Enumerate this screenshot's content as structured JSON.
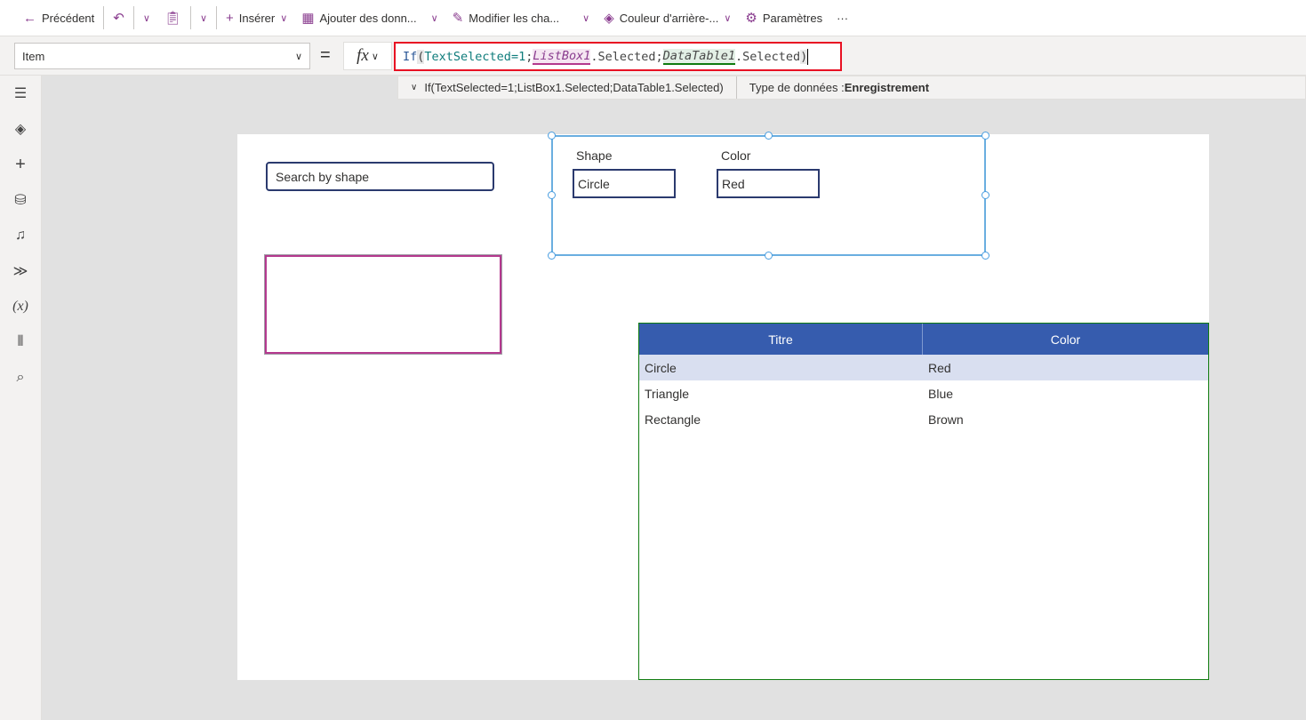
{
  "toolbar": {
    "back": "Précédent",
    "insert": "Insérer",
    "add_data": "Ajouter des donn...",
    "edit_fields": "Modifier les cha...",
    "background": "Couleur d'arrière-...",
    "settings": "Paramètres",
    "more": "···"
  },
  "formula_bar": {
    "property": "Item",
    "equals": "=",
    "fx": "fx",
    "tokens": {
      "if": "If",
      "open": "(",
      "cond": "TextSelected=1",
      "sep1": ";",
      "listbox": "ListBox1",
      "sel1": ".Selected",
      "sep2": ";",
      "datatable": "DataTable1",
      "sel2": ".Selected",
      "close": ")"
    },
    "hint_formula": "If(TextSelected=1;ListBox1.Selected;DataTable1.Selected)",
    "type_label": "Type de données :",
    "type_value": "Enregistrement"
  },
  "canvas": {
    "search_placeholder": "Search by shape",
    "form": {
      "shape_label": "Shape",
      "shape_value": "Circle",
      "color_label": "Color",
      "color_value": "Red"
    },
    "table": {
      "headers": [
        "Titre",
        "Color"
      ],
      "rows": [
        [
          "Circle",
          "Red"
        ],
        [
          "Triangle",
          "Blue"
        ],
        [
          "Rectangle",
          "Brown"
        ]
      ],
      "selected_row": 0
    }
  },
  "colors": {
    "accent": "#8a3d8f",
    "table_header": "#365cae",
    "formula_border": "#e81123",
    "listbox_border": "#b4398e",
    "table_border": "#107c10"
  }
}
